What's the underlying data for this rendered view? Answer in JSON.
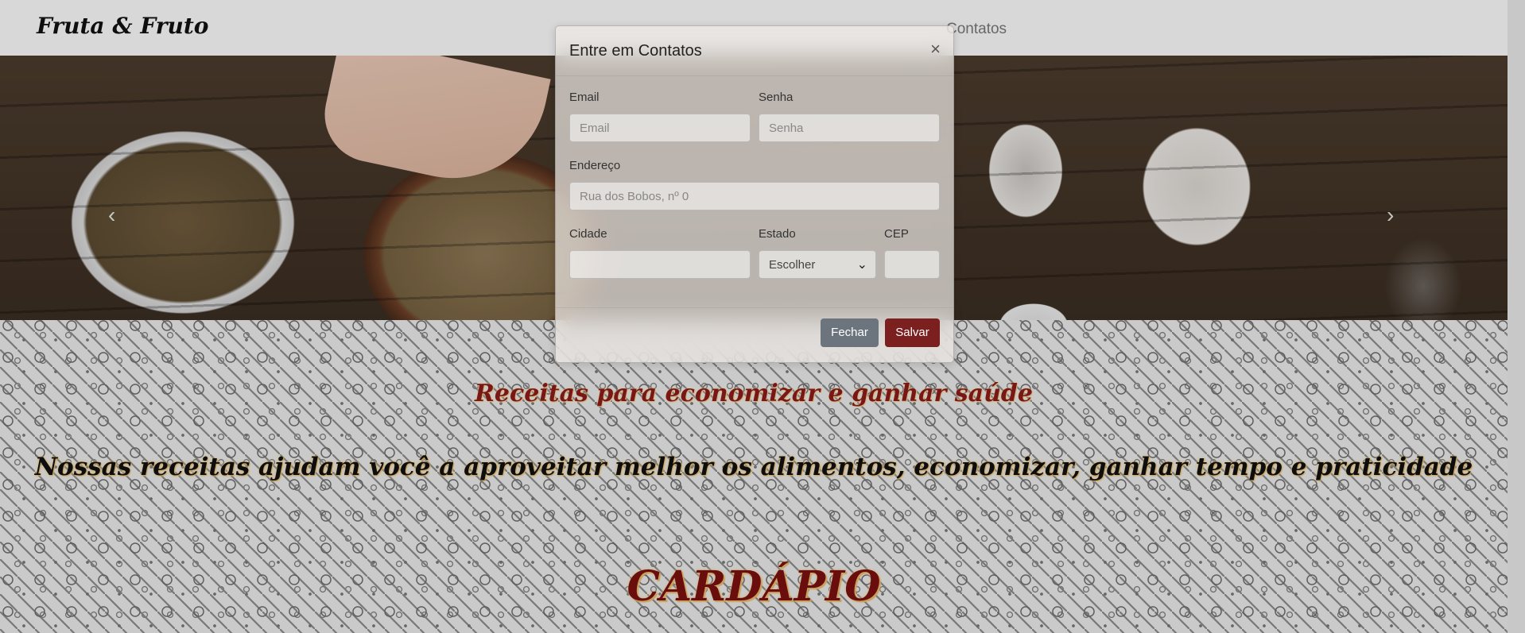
{
  "navbar": {
    "brand": "Fruta & Fruto",
    "links": [
      {
        "label": "Contatos"
      }
    ]
  },
  "carousel": {
    "prev_icon": "chevron-left-icon",
    "next_icon": "chevron-right-icon",
    "prev_glyph": "‹",
    "next_glyph": "›"
  },
  "modal": {
    "title": "Entre em Contatos",
    "close_glyph": "×",
    "email": {
      "label": "Email",
      "placeholder": "Email",
      "value": ""
    },
    "senha": {
      "label": "Senha",
      "placeholder": "Senha",
      "value": ""
    },
    "endereco": {
      "label": "Endereço",
      "placeholder": "Rua dos Bobos, nº 0",
      "value": ""
    },
    "cidade": {
      "label": "Cidade",
      "value": ""
    },
    "estado": {
      "label": "Estado",
      "selected": "Escolher"
    },
    "cep": {
      "label": "CEP",
      "value": ""
    },
    "buttons": {
      "fechar": "Fechar",
      "salvar": "Salvar"
    }
  },
  "content": {
    "receitas_heading": "Receitas para economizar e ganhar saúde",
    "nossas_heading": "Nossas receitas ajudam você a aproveitar melhor os alimentos, economizar, ganhar tempo e praticidade",
    "cardapio_heading": "CARDÁPIO"
  },
  "colors": {
    "navbar_bg": "#f8f9fa",
    "fechar_button": "#6c757d",
    "salvar_button": "#7b1f1f",
    "heading_red": "#8b1a1a"
  }
}
